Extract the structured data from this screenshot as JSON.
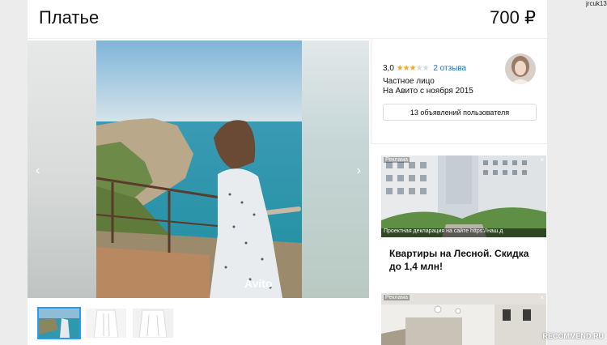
{
  "user": {
    "name": "jrcuk13"
  },
  "listing": {
    "title": "Платье",
    "price": "700 ₽"
  },
  "gallery": {
    "prev_arrow": "‹",
    "next_arrow": "›",
    "watermark": "Avito"
  },
  "seller": {
    "rating_value": "3,0",
    "rating_stars": 3,
    "rating_max": 5,
    "reviews_link": "2 отзыва",
    "type": "Частное лицо",
    "since": "На Авито с ноября 2015",
    "all_ads_button": "13 объявлений пользователя"
  },
  "ads": [
    {
      "label": "Реклама",
      "caption": "Проектная декларация на сайте https://наш.д",
      "headline": "Квартиры на Лесной. Скидка до 1,4 млн!",
      "close_icon": "×"
    },
    {
      "label": "Реклама",
      "close_icon": "×"
    }
  ],
  "site_watermark": "RECOMMEND.RU",
  "colors": {
    "accent_link": "#1a73c7",
    "star": "#f5a623",
    "thumb_active": "#2b9cf1"
  }
}
